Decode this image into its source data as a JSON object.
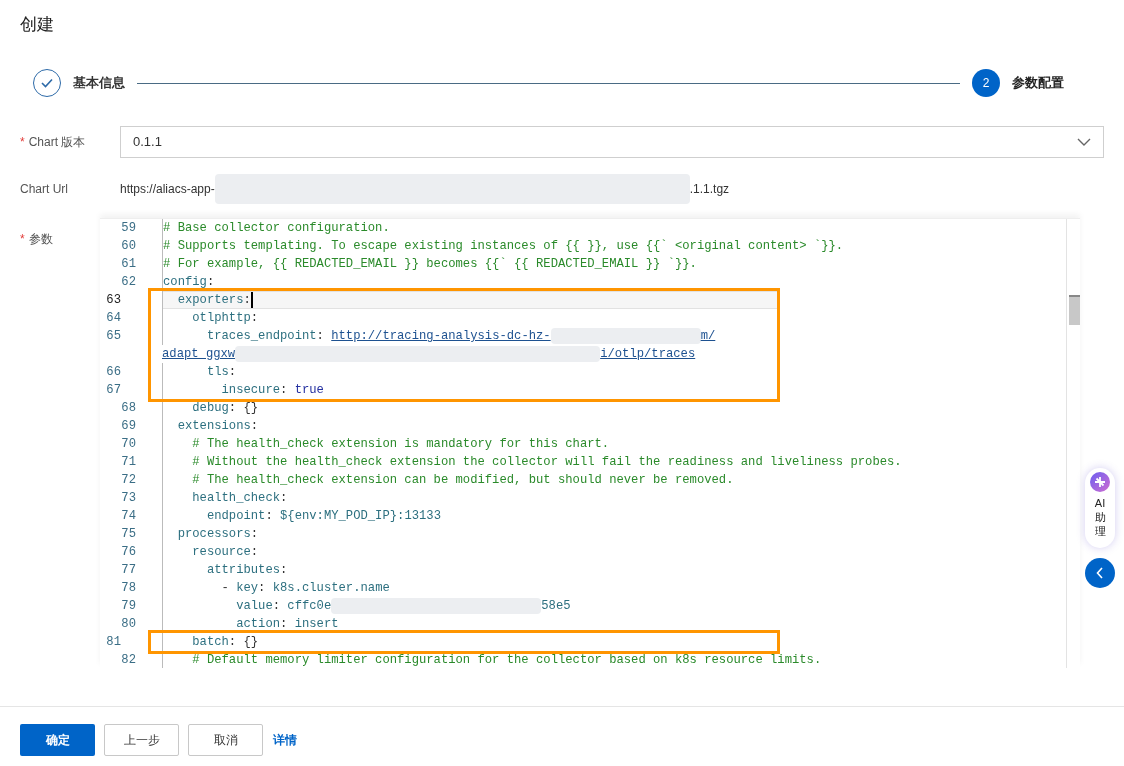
{
  "title": "创建",
  "steps": [
    {
      "label": "基本信息",
      "completed": true
    },
    {
      "label": "参数配置",
      "completed": false,
      "number": "2"
    }
  ],
  "form": {
    "version": {
      "label": "Chart 版本",
      "required_mark": "*",
      "value": "0.1.1"
    },
    "url": {
      "label": "Chart Url",
      "parts": [
        {
          "kind": "text",
          "text": "https://aliacs-app-"
        },
        {
          "kind": "redacted"
        },
        {
          "kind": "text",
          "text": ".1.1.tgz"
        }
      ]
    },
    "params": {
      "label": "参数",
      "required_mark": "*"
    }
  },
  "editor": {
    "lines": [
      {
        "number": "59",
        "active": false,
        "boxed": false,
        "segments": [
          {
            "kind": "comment",
            "text": "# Base collector configuration."
          }
        ]
      },
      {
        "number": "60",
        "active": false,
        "boxed": false,
        "segments": [
          {
            "kind": "comment",
            "text": "# Supports templating. To escape existing instances of {{ }}, use {{` <original content> `}}."
          }
        ]
      },
      {
        "number": "61",
        "active": false,
        "boxed": false,
        "segments": [
          {
            "kind": "comment",
            "text": "# For example, {{ REDACTED_EMAIL }} becomes {{` {{ REDACTED_EMAIL }} `}}."
          }
        ]
      },
      {
        "number": "62",
        "active": false,
        "boxed": false,
        "segments": [
          {
            "kind": "key",
            "text": "config"
          },
          {
            "kind": "plain",
            "text": ":"
          }
        ]
      },
      {
        "number": "63",
        "active": true,
        "boxed": true,
        "segments": [
          {
            "kind": "key",
            "text": "  exporters"
          },
          {
            "kind": "plain",
            "text": ":"
          }
        ]
      },
      {
        "number": "64",
        "active": false,
        "boxed": true,
        "segments": [
          {
            "kind": "key",
            "text": "    otlphttp"
          },
          {
            "kind": "plain",
            "text": ":"
          }
        ]
      },
      {
        "number": "65",
        "active": false,
        "boxed": true,
        "segments": [
          {
            "kind": "key",
            "text": "      traces_endpoint"
          },
          {
            "kind": "plain",
            "text": ": "
          },
          {
            "kind": "link",
            "text": "http://tracing-analysis-dc-hz-"
          },
          {
            "kind": "redacted"
          },
          {
            "kind": "link",
            "text": "m/"
          },
          {
            "kind": "break"
          },
          {
            "kind": "link",
            "text": "adapt_ggxw"
          },
          {
            "kind": "redacted"
          },
          {
            "kind": "link",
            "text": "i/otlp/traces"
          }
        ]
      },
      {
        "number": "66",
        "active": false,
        "boxed": true,
        "segments": [
          {
            "kind": "key",
            "text": "      tls"
          },
          {
            "kind": "plain",
            "text": ":"
          }
        ]
      },
      {
        "number": "67",
        "active": false,
        "boxed": true,
        "segments": [
          {
            "kind": "key",
            "text": "        insecure"
          },
          {
            "kind": "plain",
            "text": ": "
          },
          {
            "kind": "bool",
            "text": "true"
          }
        ]
      },
      {
        "number": "68",
        "active": false,
        "boxed": false,
        "segments": [
          {
            "kind": "key",
            "text": "    debug"
          },
          {
            "kind": "plain",
            "text": ": {}"
          }
        ]
      },
      {
        "number": "69",
        "active": false,
        "boxed": false,
        "segments": [
          {
            "kind": "key",
            "text": "  extensions"
          },
          {
            "kind": "plain",
            "text": ":"
          }
        ]
      },
      {
        "number": "70",
        "active": false,
        "boxed": false,
        "segments": [
          {
            "kind": "comment",
            "text": "    # The health_check extension is mandatory for this chart."
          }
        ]
      },
      {
        "number": "71",
        "active": false,
        "boxed": false,
        "segments": [
          {
            "kind": "comment",
            "text": "    # Without the health_check extension the collector will fail the readiness and liveliness probes."
          }
        ]
      },
      {
        "number": "72",
        "active": false,
        "boxed": false,
        "segments": [
          {
            "kind": "comment",
            "text": "    # The health_check extension can be modified, but should never be removed."
          }
        ]
      },
      {
        "number": "73",
        "active": false,
        "boxed": false,
        "segments": [
          {
            "kind": "key",
            "text": "    health_check"
          },
          {
            "kind": "plain",
            "text": ":"
          }
        ]
      },
      {
        "number": "74",
        "active": false,
        "boxed": false,
        "segments": [
          {
            "kind": "key",
            "text": "      endpoint"
          },
          {
            "kind": "plain",
            "text": ": "
          },
          {
            "kind": "value",
            "text": "${env:MY_POD_IP}:13133"
          }
        ]
      },
      {
        "number": "75",
        "active": false,
        "boxed": false,
        "segments": [
          {
            "kind": "key",
            "text": "  processors"
          },
          {
            "kind": "plain",
            "text": ":"
          }
        ]
      },
      {
        "number": "76",
        "active": false,
        "boxed": false,
        "segments": [
          {
            "kind": "key",
            "text": "    resource"
          },
          {
            "kind": "plain",
            "text": ":"
          }
        ]
      },
      {
        "number": "77",
        "active": false,
        "boxed": false,
        "segments": [
          {
            "kind": "key",
            "text": "      attributes"
          },
          {
            "kind": "plain",
            "text": ":"
          }
        ]
      },
      {
        "number": "78",
        "active": false,
        "boxed": false,
        "segments": [
          {
            "kind": "plain",
            "text": "        - "
          },
          {
            "kind": "key",
            "text": "key"
          },
          {
            "kind": "plain",
            "text": ": "
          },
          {
            "kind": "value",
            "text": "k8s.cluster.name"
          }
        ]
      },
      {
        "number": "79",
        "active": false,
        "boxed": false,
        "segments": [
          {
            "kind": "key",
            "text": "          value"
          },
          {
            "kind": "plain",
            "text": ": "
          },
          {
            "kind": "value",
            "text": "cffc0e"
          },
          {
            "kind": "redacted"
          },
          {
            "kind": "value",
            "text": "58e5"
          }
        ]
      },
      {
        "number": "80",
        "active": false,
        "boxed": false,
        "segments": [
          {
            "kind": "key",
            "text": "          action"
          },
          {
            "kind": "plain",
            "text": ": "
          },
          {
            "kind": "value",
            "text": "insert"
          }
        ]
      },
      {
        "number": "81",
        "active": false,
        "boxed": true,
        "segments": [
          {
            "kind": "key",
            "text": "    batch"
          },
          {
            "kind": "plain",
            "text": ": {}"
          }
        ]
      },
      {
        "number": "82",
        "active": false,
        "boxed": false,
        "segments": [
          {
            "kind": "comment",
            "text": "    # Default memory limiter configuration for the collector based on k8s resource limits."
          }
        ]
      }
    ]
  },
  "assistant": {
    "label": "AI助理"
  },
  "buttons": [
    {
      "label": "确定",
      "kind": "primary"
    },
    {
      "label": "上一步",
      "kind": "default"
    },
    {
      "label": "取消",
      "kind": "default"
    },
    {
      "label": "详情",
      "kind": "link"
    }
  ]
}
